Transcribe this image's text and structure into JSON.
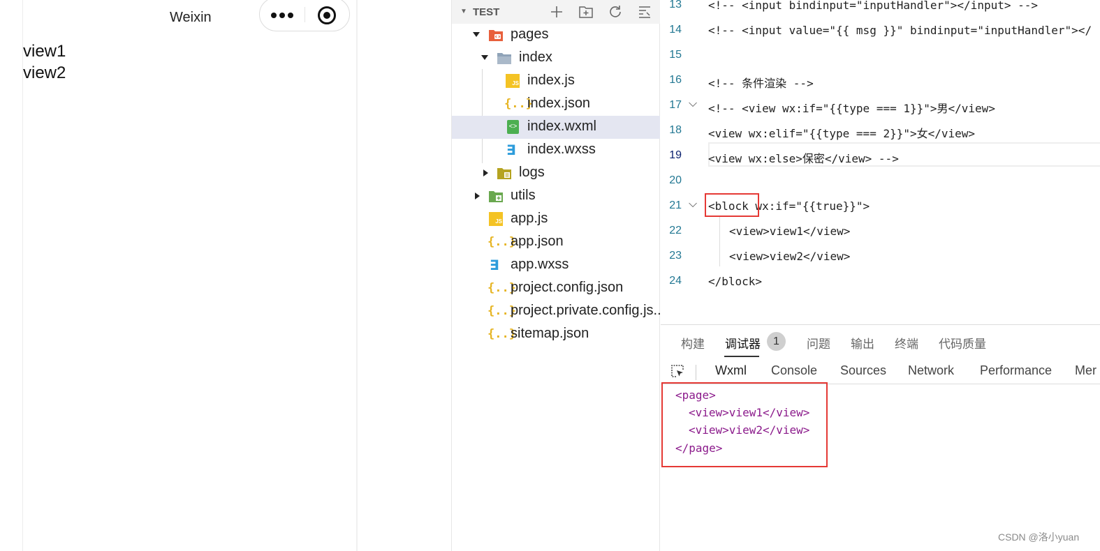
{
  "simulator": {
    "title": "Weixin",
    "views": [
      "view1",
      "view2"
    ]
  },
  "explorer": {
    "title": "TEST",
    "header_icons": [
      "new-file-icon",
      "new-folder-icon",
      "refresh-icon",
      "collapse-all-icon"
    ],
    "tree": [
      {
        "label": "pages",
        "type": "folder-open",
        "icon": "pages-folder-icon"
      },
      {
        "label": "index",
        "type": "folder-open",
        "icon": "folder-icon"
      },
      {
        "label": "index.js",
        "type": "js"
      },
      {
        "label": "index.json",
        "type": "json"
      },
      {
        "label": "index.wxml",
        "type": "wxml",
        "selected": true
      },
      {
        "label": "index.wxss",
        "type": "wxss"
      },
      {
        "label": "logs",
        "type": "folder-closed"
      },
      {
        "label": "utils",
        "type": "folder-closed"
      },
      {
        "label": "app.js",
        "type": "js"
      },
      {
        "label": "app.json",
        "type": "json"
      },
      {
        "label": "app.wxss",
        "type": "wxss"
      },
      {
        "label": "project.config.json",
        "type": "json"
      },
      {
        "label": "project.private.config.js...",
        "type": "json"
      },
      {
        "label": "sitemap.json",
        "type": "json"
      }
    ]
  },
  "editor": {
    "lines": [
      {
        "num": "13",
        "text": "<!-- <input bindinput=\"inputHandler\"></input> -->"
      },
      {
        "num": "14",
        "text": "<!-- <input value=\"{{ msg }}\" bindinput=\"inputHandler\"></"
      },
      {
        "num": "15",
        "text": ""
      },
      {
        "num": "16",
        "text": "<!-- 条件渲染 -->"
      },
      {
        "num": "17",
        "text": "<!-- <view wx:if=\"{{type === 1}}\">男</view>"
      },
      {
        "num": "18",
        "text": "<view wx:elif=\"{{type === 2}}\">女</view>"
      },
      {
        "num": "19",
        "text": "<view wx:else>保密</view> -->"
      },
      {
        "num": "20",
        "text": ""
      },
      {
        "num": "21",
        "text": "<block wx:if=\"{{true}}\">"
      },
      {
        "num": "22",
        "text": "<view>view1</view>"
      },
      {
        "num": "23",
        "text": "<view>view2</view>"
      },
      {
        "num": "24",
        "text": "</block>"
      }
    ]
  },
  "panel": {
    "tabs": [
      "构建",
      "调试器",
      "问题",
      "输出",
      "终端",
      "代码质量"
    ],
    "badge": "1",
    "subtabs": [
      "Wxml",
      "Console",
      "Sources",
      "Network",
      "Performance",
      "Mer"
    ],
    "dom": [
      "<page>",
      "<view>view1</view>",
      "<view>view2</view>",
      "</page>"
    ]
  },
  "watermark": "CSDN @洛小yuan",
  "colors": {
    "highlight_box": "#e53935",
    "selected_row": "#e4e6f1",
    "comment": "#3fa33f",
    "tag": "#d03b6a"
  }
}
